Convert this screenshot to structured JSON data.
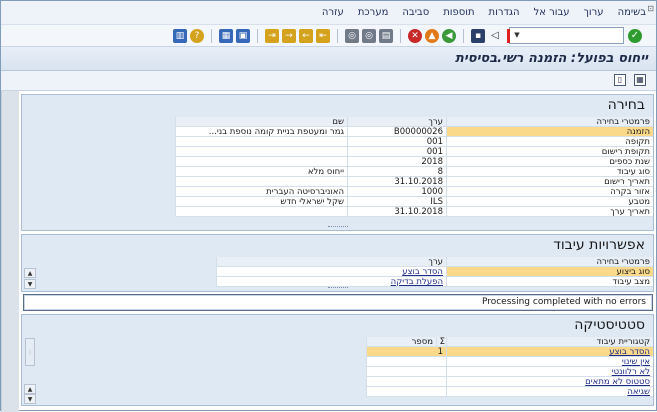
{
  "menu": {
    "items": [
      "בשימה",
      "ערוך",
      "עבור אל",
      "הגדרות",
      "תוספות",
      "סביבה",
      "מערכת",
      "עזרה"
    ]
  },
  "toolbar": {
    "command_value": "",
    "icons": [
      "ok-check-icon",
      "save-icon",
      "back-icon",
      "exit-icon",
      "cancel-icon",
      "print-icon",
      "find-icon",
      "find-next-icon",
      "first-page-icon",
      "prev-page-icon",
      "next-page-icon",
      "last-page-icon",
      "create-session-icon",
      "shortcut-icon",
      "help-icon",
      "customize-layout-icon"
    ]
  },
  "title": "ייחוס בפועל: הזמנה רשי.בסיסית",
  "selection": {
    "title": "בחירה",
    "headers": {
      "param": "פרמטרי בחירה",
      "value": "ערך",
      "name": "שם"
    },
    "rows": [
      {
        "param": "הזמנה",
        "value": "B00000026",
        "name": "גמר ומעטפת בניית קומה נוספת בני..."
      },
      {
        "param": "תקופה",
        "value": "001",
        "name": ""
      },
      {
        "param": "תקופת רישום",
        "value": "001",
        "name": ""
      },
      {
        "param": "שנת כספים",
        "value": "2018",
        "name": ""
      },
      {
        "param": "סוג עיבוד",
        "value": "8",
        "name": "ייחוס מלא"
      },
      {
        "param": "תאריך רישום",
        "value": "31.10.2018",
        "name": ""
      },
      {
        "param": "אזור בקרה",
        "value": "1000",
        "name": "האוניברסיטה העברית"
      },
      {
        "param": "מטבע",
        "value": "ILS",
        "name": "שקל ישראלי חדש"
      },
      {
        "param": "תאריך ערך",
        "value": "31.10.2018",
        "name": ""
      }
    ]
  },
  "processing": {
    "title": "אפשרויות עיבוד",
    "headers": {
      "param": "פרמטרי בחירה",
      "value": "ערך"
    },
    "rows": [
      {
        "param": "סוג ביצוע",
        "value": "הסדר בוצע"
      },
      {
        "param": "מצב עיבוד",
        "value": "הפעלת בדיקה"
      }
    ]
  },
  "status": {
    "message": "Processing completed with no errors"
  },
  "statistics": {
    "title": "סטטיסטיקה",
    "headers": {
      "category": "קטגוריית עיבוד",
      "count": "מספר",
      "sigma": "Σ"
    },
    "rows": [
      {
        "category": "הסדר בוצע",
        "count": "1"
      },
      {
        "category": "אין שינוי",
        "count": ""
      },
      {
        "category": "לא רלוונטי",
        "count": ""
      },
      {
        "category": "סטטוס לא מתאים",
        "count": ""
      },
      {
        "category": "שגיאה",
        "count": ""
      }
    ]
  }
}
